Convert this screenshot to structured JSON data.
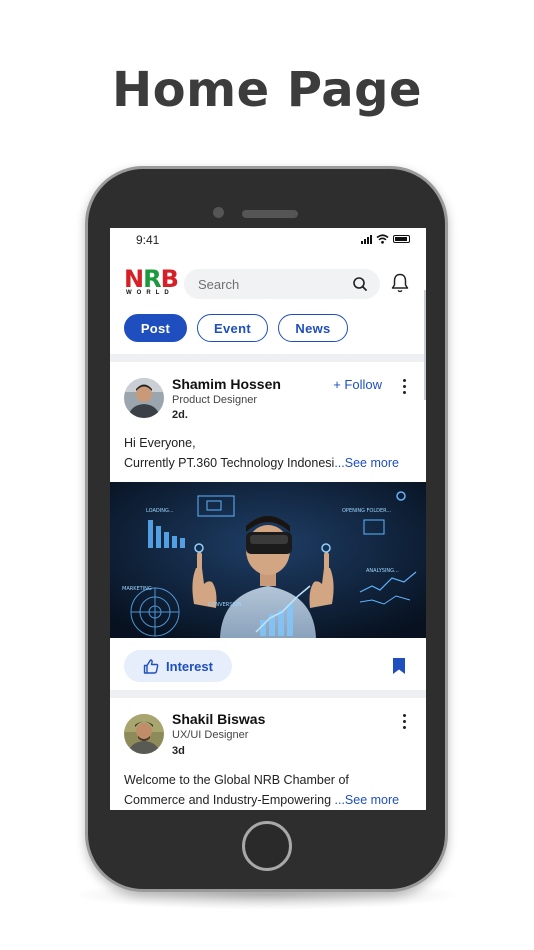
{
  "page": {
    "title": "Home Page"
  },
  "status": {
    "time": "9:41"
  },
  "logo": {
    "main_n": "N",
    "main_r": "R",
    "main_b": "B",
    "sub": "WORLD"
  },
  "search": {
    "placeholder": "Search"
  },
  "tabs": [
    {
      "label": "Post",
      "active": true
    },
    {
      "label": "Event",
      "active": false
    },
    {
      "label": "News",
      "active": false
    }
  ],
  "posts": [
    {
      "author": "Shamim Hossen",
      "role": "Product Designer",
      "time": "2d.",
      "follow_label": "+ Follow",
      "text_line1": "Hi Everyone,",
      "text_line2": "Currently PT.360 Technology Indonesi",
      "see_more": "...See more",
      "interest_label": "Interest",
      "image_labels": [
        "LOADING...",
        "OPENING FOLDER...",
        "MARKETING",
        "CONVERSION",
        "ANALYSING..."
      ]
    },
    {
      "author": "Shakil Biswas",
      "role": "UX/UI Designer",
      "time": "3d",
      "text_line1": "Welcome to the Global NRB Chamber of",
      "text_line2": "Commerce and Industry-Empowering ",
      "see_more": "...See more"
    }
  ],
  "colors": {
    "accent": "#1f4fbf",
    "accent_light": "#e7eefb",
    "logo_red": "#d71f26",
    "logo_green": "#1a9a3c"
  }
}
